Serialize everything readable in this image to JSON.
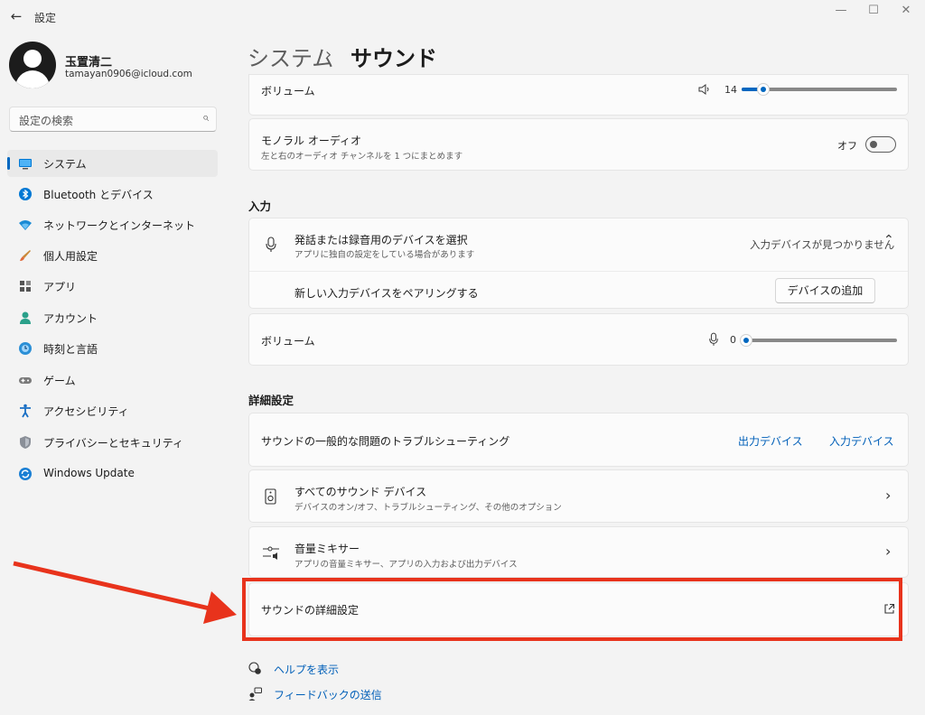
{
  "window": {
    "title": "設定",
    "back": "←",
    "minimize": "—",
    "maximize": "☐",
    "close": "✕"
  },
  "profile": {
    "name": "玉置清二",
    "email": "tamayan0906@icloud.com"
  },
  "search": {
    "placeholder": "設定の検索",
    "icon": "⌕"
  },
  "sidebar": {
    "items": [
      {
        "label": "システム",
        "icon": "system-icon",
        "active": true
      },
      {
        "label": "Bluetooth とデバイス",
        "icon": "bluetooth-icon"
      },
      {
        "label": "ネットワークとインターネット",
        "icon": "network-icon"
      },
      {
        "label": "個人用設定",
        "icon": "brush-icon"
      },
      {
        "label": "アプリ",
        "icon": "apps-icon"
      },
      {
        "label": "アカウント",
        "icon": "account-icon"
      },
      {
        "label": "時刻と言語",
        "icon": "time-language-icon"
      },
      {
        "label": "ゲーム",
        "icon": "gamepad-icon"
      },
      {
        "label": "アクセシビリティ",
        "icon": "accessibility-icon"
      },
      {
        "label": "プライバシーとセキュリティ",
        "icon": "shield-icon"
      },
      {
        "label": "Windows Update",
        "icon": "windows-update-icon"
      }
    ]
  },
  "breadcrumb": {
    "parent": "システム",
    "separator": "›",
    "current": "サウンド"
  },
  "output": {
    "volume_label": "ボリューム",
    "volume_value": "14",
    "volume_level": 14,
    "mono_title": "モノラル オーディオ",
    "mono_sub": "左と右のオーディオ チャンネルを 1 つにまとめます",
    "mono_state": "オフ"
  },
  "input": {
    "heading": "入力",
    "device_title": "発話または録音用のデバイスを選択",
    "device_sub": "アプリに独自の設定をしている場合があります",
    "device_status": "入力デバイスが見つかりません",
    "pair_label": "新しい入力デバイスをペアリングする",
    "add_device_button": "デバイスの追加",
    "volume_label": "ボリューム",
    "volume_value": "0",
    "volume_level": 0
  },
  "advanced": {
    "heading": "詳細設定",
    "troubleshoot_label": "サウンドの一般的な問題のトラブルシューティング",
    "output_devices_link": "出力デバイス",
    "input_devices_link": "入力デバイス",
    "all_devices_title": "すべてのサウンド デバイス",
    "all_devices_sub": "デバイスのオン/オフ、トラブルシューティング、その他のオプション",
    "mixer_title": "音量ミキサー",
    "mixer_sub": "アプリの音量ミキサー、アプリの入力および出力デバイス",
    "more_settings_label": "サウンドの詳細設定"
  },
  "footer": {
    "help_link": "ヘルプを表示",
    "feedback_link": "フィードバックの送信"
  },
  "colors": {
    "accent": "#0067c0",
    "annotation": "#e8331c"
  }
}
